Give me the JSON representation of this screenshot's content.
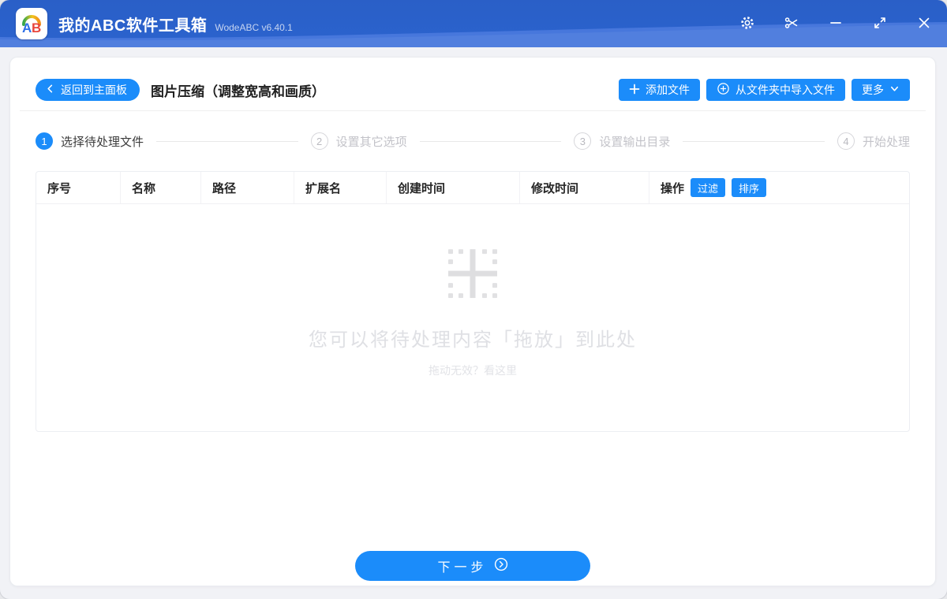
{
  "window": {
    "title": "我的ABC软件工具箱",
    "version": "WodeABC v6.40.1",
    "logo": {
      "letter_a": "A",
      "letter_b": "B"
    }
  },
  "header": {
    "back_label": "返回到主面板",
    "page_title": "图片压缩（调整宽高和画质）",
    "add_files_label": "添加文件",
    "import_folder_label": "从文件夹中导入文件",
    "more_label": "更多"
  },
  "steps": [
    {
      "num": "1",
      "label": "选择待处理文件",
      "state": "active"
    },
    {
      "num": "2",
      "label": "设置其它选项",
      "state": "pending"
    },
    {
      "num": "3",
      "label": "设置输出目录",
      "state": "pending"
    },
    {
      "num": "4",
      "label": "开始处理",
      "state": "pending"
    }
  ],
  "table": {
    "columns": [
      "序号",
      "名称",
      "路径",
      "扩展名",
      "创建时间",
      "修改时间",
      "操作"
    ],
    "filter_button": "过滤",
    "sort_button": "排序",
    "rows": []
  },
  "empty_state": {
    "message": "您可以将待处理内容「拖放」到此处",
    "hint": "拖动无效？看这里"
  },
  "footer": {
    "next_label": "下一步"
  },
  "colors": {
    "titlebar": "#2b63ce",
    "titlebar_wave": "#4777dc",
    "accent": "#1b8cfa"
  }
}
